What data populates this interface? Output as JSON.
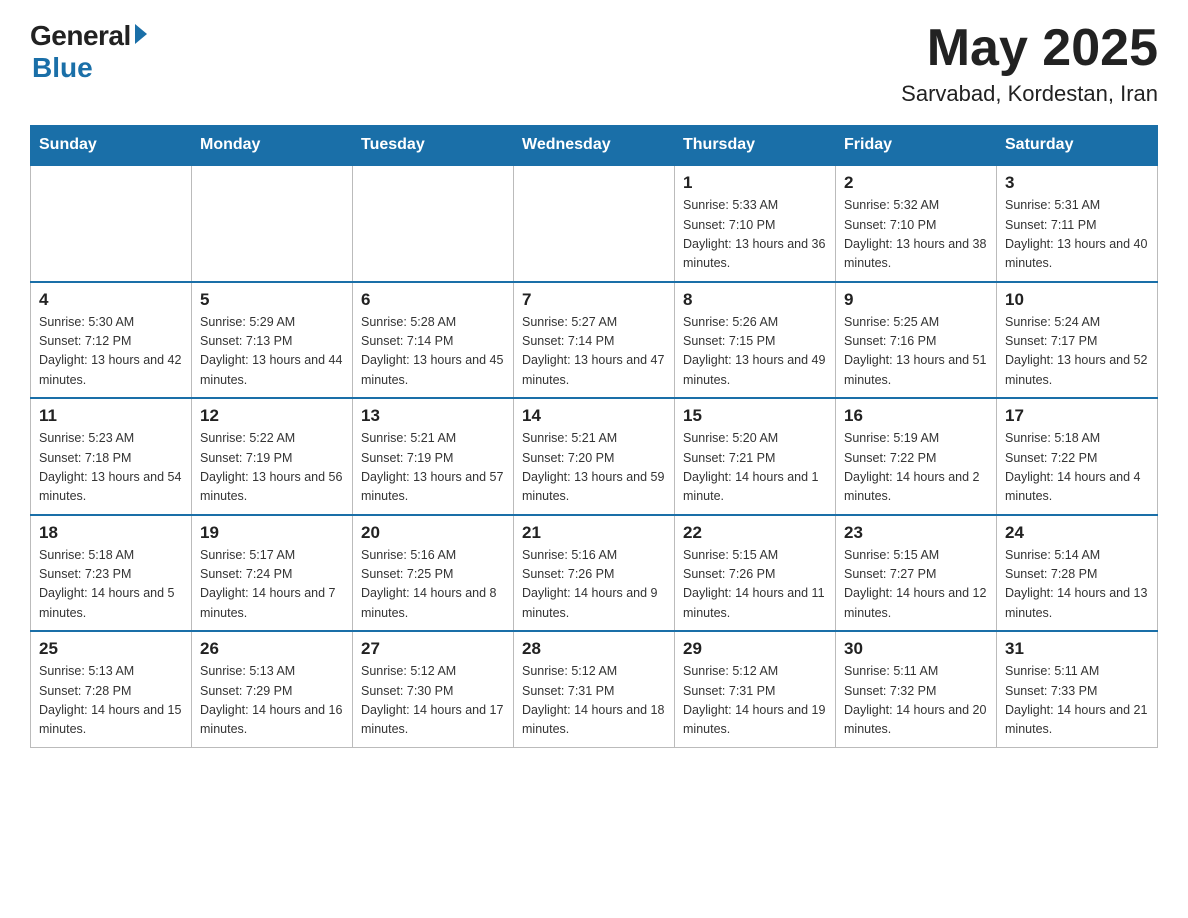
{
  "header": {
    "logo": {
      "general": "General",
      "blue": "Blue"
    },
    "month_year": "May 2025",
    "location": "Sarvabad, Kordestan, Iran"
  },
  "days_of_week": [
    "Sunday",
    "Monday",
    "Tuesday",
    "Wednesday",
    "Thursday",
    "Friday",
    "Saturday"
  ],
  "weeks": [
    [
      {
        "day": "",
        "info": ""
      },
      {
        "day": "",
        "info": ""
      },
      {
        "day": "",
        "info": ""
      },
      {
        "day": "",
        "info": ""
      },
      {
        "day": "1",
        "info": "Sunrise: 5:33 AM\nSunset: 7:10 PM\nDaylight: 13 hours and 36 minutes."
      },
      {
        "day": "2",
        "info": "Sunrise: 5:32 AM\nSunset: 7:10 PM\nDaylight: 13 hours and 38 minutes."
      },
      {
        "day": "3",
        "info": "Sunrise: 5:31 AM\nSunset: 7:11 PM\nDaylight: 13 hours and 40 minutes."
      }
    ],
    [
      {
        "day": "4",
        "info": "Sunrise: 5:30 AM\nSunset: 7:12 PM\nDaylight: 13 hours and 42 minutes."
      },
      {
        "day": "5",
        "info": "Sunrise: 5:29 AM\nSunset: 7:13 PM\nDaylight: 13 hours and 44 minutes."
      },
      {
        "day": "6",
        "info": "Sunrise: 5:28 AM\nSunset: 7:14 PM\nDaylight: 13 hours and 45 minutes."
      },
      {
        "day": "7",
        "info": "Sunrise: 5:27 AM\nSunset: 7:14 PM\nDaylight: 13 hours and 47 minutes."
      },
      {
        "day": "8",
        "info": "Sunrise: 5:26 AM\nSunset: 7:15 PM\nDaylight: 13 hours and 49 minutes."
      },
      {
        "day": "9",
        "info": "Sunrise: 5:25 AM\nSunset: 7:16 PM\nDaylight: 13 hours and 51 minutes."
      },
      {
        "day": "10",
        "info": "Sunrise: 5:24 AM\nSunset: 7:17 PM\nDaylight: 13 hours and 52 minutes."
      }
    ],
    [
      {
        "day": "11",
        "info": "Sunrise: 5:23 AM\nSunset: 7:18 PM\nDaylight: 13 hours and 54 minutes."
      },
      {
        "day": "12",
        "info": "Sunrise: 5:22 AM\nSunset: 7:19 PM\nDaylight: 13 hours and 56 minutes."
      },
      {
        "day": "13",
        "info": "Sunrise: 5:21 AM\nSunset: 7:19 PM\nDaylight: 13 hours and 57 minutes."
      },
      {
        "day": "14",
        "info": "Sunrise: 5:21 AM\nSunset: 7:20 PM\nDaylight: 13 hours and 59 minutes."
      },
      {
        "day": "15",
        "info": "Sunrise: 5:20 AM\nSunset: 7:21 PM\nDaylight: 14 hours and 1 minute."
      },
      {
        "day": "16",
        "info": "Sunrise: 5:19 AM\nSunset: 7:22 PM\nDaylight: 14 hours and 2 minutes."
      },
      {
        "day": "17",
        "info": "Sunrise: 5:18 AM\nSunset: 7:22 PM\nDaylight: 14 hours and 4 minutes."
      }
    ],
    [
      {
        "day": "18",
        "info": "Sunrise: 5:18 AM\nSunset: 7:23 PM\nDaylight: 14 hours and 5 minutes."
      },
      {
        "day": "19",
        "info": "Sunrise: 5:17 AM\nSunset: 7:24 PM\nDaylight: 14 hours and 7 minutes."
      },
      {
        "day": "20",
        "info": "Sunrise: 5:16 AM\nSunset: 7:25 PM\nDaylight: 14 hours and 8 minutes."
      },
      {
        "day": "21",
        "info": "Sunrise: 5:16 AM\nSunset: 7:26 PM\nDaylight: 14 hours and 9 minutes."
      },
      {
        "day": "22",
        "info": "Sunrise: 5:15 AM\nSunset: 7:26 PM\nDaylight: 14 hours and 11 minutes."
      },
      {
        "day": "23",
        "info": "Sunrise: 5:15 AM\nSunset: 7:27 PM\nDaylight: 14 hours and 12 minutes."
      },
      {
        "day": "24",
        "info": "Sunrise: 5:14 AM\nSunset: 7:28 PM\nDaylight: 14 hours and 13 minutes."
      }
    ],
    [
      {
        "day": "25",
        "info": "Sunrise: 5:13 AM\nSunset: 7:28 PM\nDaylight: 14 hours and 15 minutes."
      },
      {
        "day": "26",
        "info": "Sunrise: 5:13 AM\nSunset: 7:29 PM\nDaylight: 14 hours and 16 minutes."
      },
      {
        "day": "27",
        "info": "Sunrise: 5:12 AM\nSunset: 7:30 PM\nDaylight: 14 hours and 17 minutes."
      },
      {
        "day": "28",
        "info": "Sunrise: 5:12 AM\nSunset: 7:31 PM\nDaylight: 14 hours and 18 minutes."
      },
      {
        "day": "29",
        "info": "Sunrise: 5:12 AM\nSunset: 7:31 PM\nDaylight: 14 hours and 19 minutes."
      },
      {
        "day": "30",
        "info": "Sunrise: 5:11 AM\nSunset: 7:32 PM\nDaylight: 14 hours and 20 minutes."
      },
      {
        "day": "31",
        "info": "Sunrise: 5:11 AM\nSunset: 7:33 PM\nDaylight: 14 hours and 21 minutes."
      }
    ]
  ]
}
